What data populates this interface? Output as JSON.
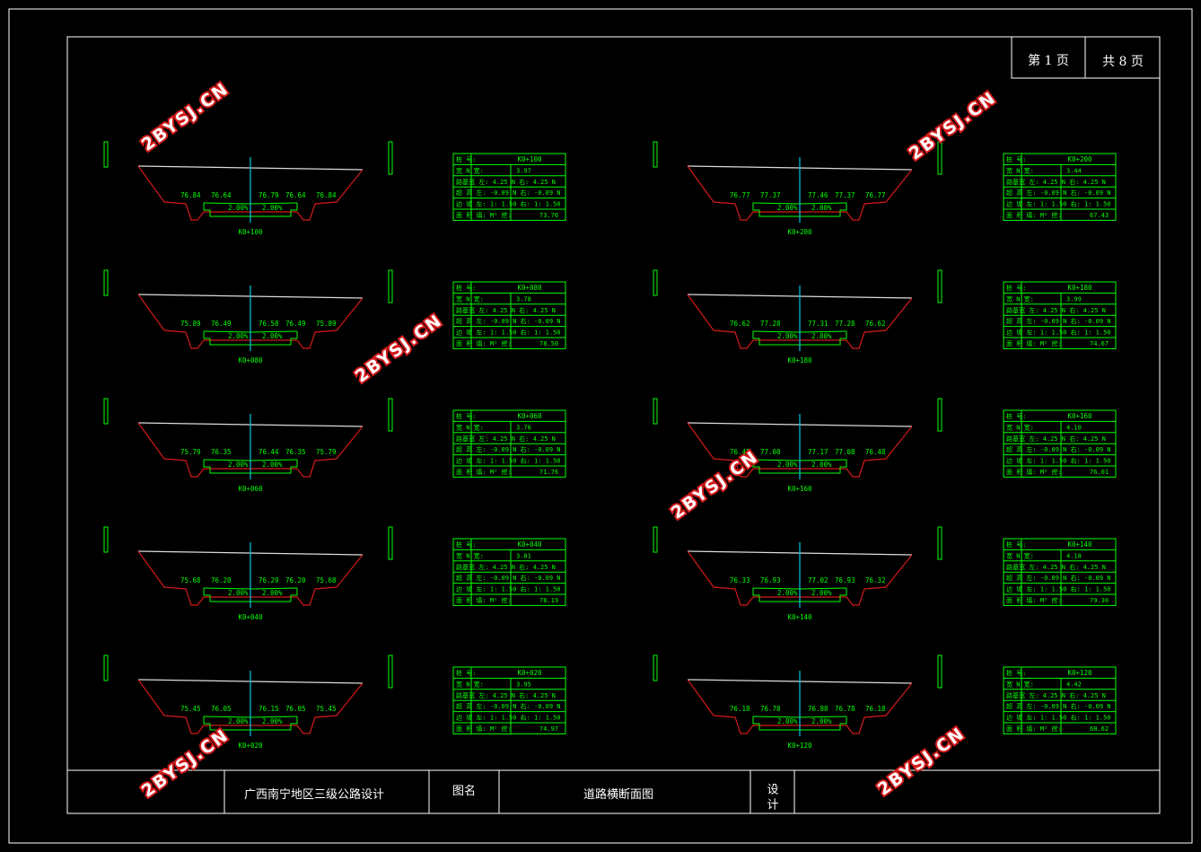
{
  "title_block": {
    "page_current": "第 1 页",
    "page_total": "共 8 页",
    "project": "广西南宁地区三级公路设计",
    "drawing_name_label": "图名",
    "drawing_name": "道路横断面图",
    "designer_label": "设 计"
  },
  "watermark": "2BYSJ.CN",
  "table_rows": {
    "station": "桩 号:",
    "hw": "宽 N 宽:",
    "road": "路基宽 左: 4.25 N 右: 4.25 N",
    "slope": "超 高 左: -0.09 N 右: -0.09 N",
    "bank": "边 坡 左: 1: 1.50 右: 1: 1.50",
    "area": "面 积 填: M² 挖:"
  },
  "sections": [
    {
      "station": "K0+100",
      "column": "left",
      "row": 0,
      "v": [
        "76.84",
        "76.64",
        "76.79",
        "76.64",
        "76.84"
      ],
      "area": "73.76",
      "dig": "3.97"
    },
    {
      "station": "K0+080",
      "column": "left",
      "row": 1,
      "v": [
        "75.89",
        "76.49",
        "76.58",
        "76.49",
        "75.89"
      ],
      "area": "78.50",
      "dig": "3.78"
    },
    {
      "station": "K0+060",
      "column": "left",
      "row": 2,
      "v": [
        "75.79",
        "76.35",
        "76.44",
        "76.35",
        "75.79"
      ],
      "area": "71.76",
      "dig": "3.76"
    },
    {
      "station": "K0+040",
      "column": "left",
      "row": 3,
      "v": [
        "75.68",
        "76.20",
        "76.29",
        "76.20",
        "75.68"
      ],
      "area": "78.19",
      "dig": "3.81"
    },
    {
      "station": "K0+020",
      "column": "left",
      "row": 4,
      "v": [
        "75.45",
        "76.05",
        "76.15",
        "76.05",
        "75.45"
      ],
      "area": "74.97",
      "dig": "3.95"
    },
    {
      "station": "K0+200",
      "column": "right",
      "row": 0,
      "v": [
        "76.77",
        "77.37",
        "77.46",
        "77.37",
        "76.77"
      ],
      "area": "67.43",
      "dig": "3.44"
    },
    {
      "station": "K0+180",
      "column": "right",
      "row": 1,
      "v": [
        "76.62",
        "77.28",
        "77.31",
        "77.28",
        "76.62"
      ],
      "area": "74.67",
      "dig": "3.99"
    },
    {
      "station": "K0+160",
      "column": "right",
      "row": 2,
      "v": [
        "76.48",
        "77.08",
        "77.17",
        "77.08",
        "76.48"
      ],
      "area": "76.01",
      "dig": "4.10"
    },
    {
      "station": "K0+140",
      "column": "right",
      "row": 3,
      "v": [
        "76.33",
        "76.93",
        "77.02",
        "76.93",
        "76.32"
      ],
      "area": "79.30",
      "dig": "4.18"
    },
    {
      "station": "K0+120",
      "column": "right",
      "row": 4,
      "v": [
        "76.18",
        "76.78",
        "76.88",
        "76.78",
        "76.18"
      ],
      "area": "68.62",
      "dig": "4.42"
    }
  ],
  "cross_slope": "2.00%",
  "colors": {
    "frame": "#ffffff",
    "grid": "#00ff00",
    "ground": "#d21a1a",
    "centerline": "#00c8e6",
    "road": "#00ff00",
    "watermark_stroke": "#d21a1a"
  }
}
